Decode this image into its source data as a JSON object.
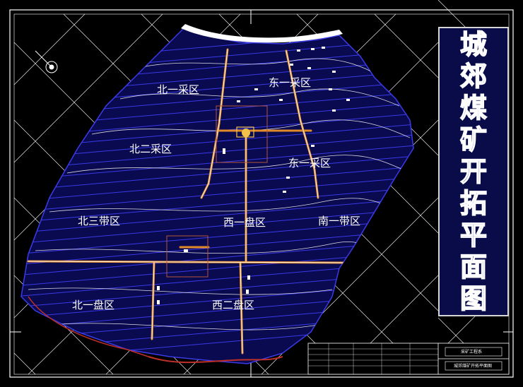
{
  "drawing": {
    "title": "城郊煤矿开拓平面图",
    "colors": {
      "background": "#000000",
      "field_fill": "#0a0a50",
      "contour": "#ffffff",
      "seam_line": "#3a3ae8",
      "roadway": "#e08a2a",
      "boundary_red": "#c0302a",
      "grid": "#ffffff",
      "title_fill": "#1a1f8a"
    },
    "zones": [
      {
        "id": "north-1-mining",
        "label": "北一采区"
      },
      {
        "id": "east-1-mining",
        "label": "东一采区"
      },
      {
        "id": "north-2-mining",
        "label": "北二采区"
      },
      {
        "id": "east-1-mining-2",
        "label": "东一采区"
      },
      {
        "id": "north-3-belt",
        "label": "北三带区"
      },
      {
        "id": "west-1-panel",
        "label": "西一盘区"
      },
      {
        "id": "south-1-belt",
        "label": "南一带区"
      },
      {
        "id": "north-1-panel",
        "label": "北一盘区"
      },
      {
        "id": "west-2-panel",
        "label": "西二盘区"
      }
    ],
    "title_block": {
      "company": "采矿工程系",
      "drawing_name": "城郊煤矿开拓平面图"
    }
  }
}
